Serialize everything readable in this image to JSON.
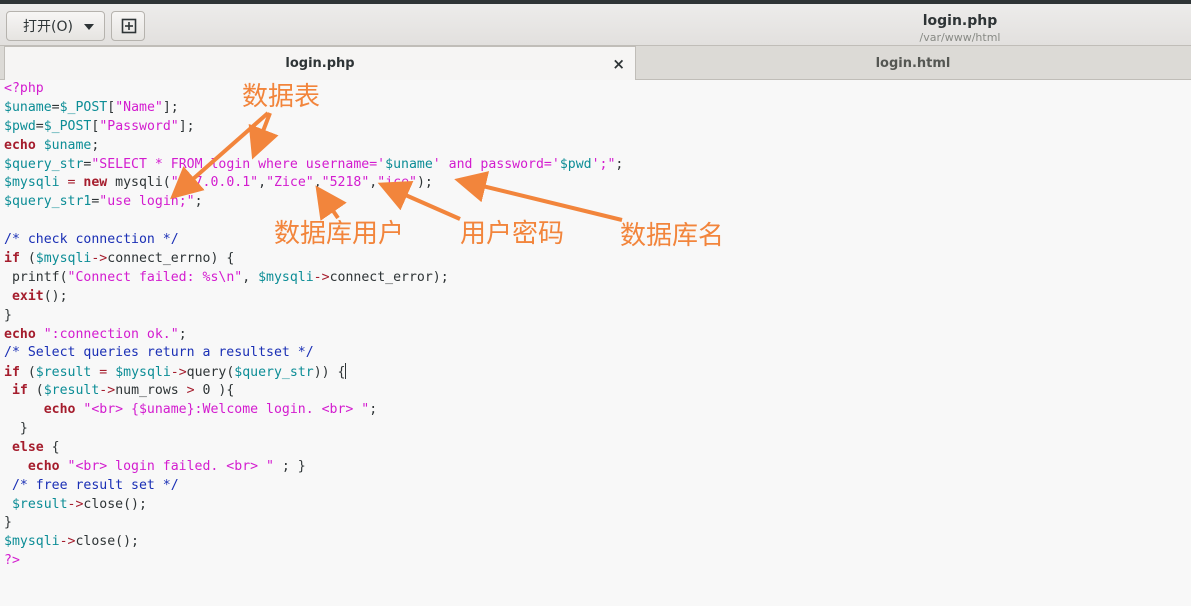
{
  "header": {
    "open_label": "打开(O)",
    "title": "login.php",
    "subtitle": "/var/www/html"
  },
  "tabs": [
    {
      "label": "login.php",
      "active": true,
      "close": "×"
    },
    {
      "label": "login.html",
      "active": false
    }
  ],
  "annotations": {
    "table": "数据表",
    "db_user": "数据库用户",
    "user_password": "用户密码",
    "db_name": "数据库名"
  },
  "colors": {
    "variable": "#0c8d96",
    "string": "#d31ccf",
    "keyword": "#a51d2d",
    "comment": "#1a2fb5",
    "annotation": "#f2853c"
  },
  "code_lines": [
    [
      [
        "p",
        "<?php"
      ]
    ],
    [
      [
        "v",
        "$uname"
      ],
      [
        "",
        "="
      ],
      [
        "v",
        "$_POST"
      ],
      [
        "",
        "["
      ],
      [
        "s",
        "\"Name\""
      ],
      [
        "",
        "];"
      ]
    ],
    [
      [
        "v",
        "$pwd"
      ],
      [
        "",
        "="
      ],
      [
        "v",
        "$_POST"
      ],
      [
        "",
        "["
      ],
      [
        "s",
        "\"Password\""
      ],
      [
        "",
        "];"
      ]
    ],
    [
      [
        "k",
        "echo"
      ],
      [
        "",
        " "
      ],
      [
        "v",
        "$uname"
      ],
      [
        "",
        ";"
      ]
    ],
    [
      [
        "v",
        "$query_str"
      ],
      [
        "",
        "="
      ],
      [
        "s",
        "\"SELECT * FROM login where username='"
      ],
      [
        "v",
        "$uname"
      ],
      [
        "s",
        "' and password='"
      ],
      [
        "v",
        "$pwd"
      ],
      [
        "s",
        "';\""
      ],
      [
        "",
        ";"
      ]
    ],
    [
      [
        "v",
        "$mysqli"
      ],
      [
        "o",
        " = "
      ],
      [
        "k",
        "new"
      ],
      [
        "",
        " mysqli("
      ],
      [
        "s",
        "\"127.0.0.1\""
      ],
      [
        "",
        ","
      ],
      [
        "s",
        "\"Zice\""
      ],
      [
        "",
        ","
      ],
      [
        "s",
        "\"5218\""
      ],
      [
        "",
        ","
      ],
      [
        "s",
        "\"ice\""
      ],
      [
        "",
        ");"
      ]
    ],
    [
      [
        "v",
        "$query_str1"
      ],
      [
        "",
        "="
      ],
      [
        "s",
        "\"use login;\""
      ],
      [
        "",
        ";"
      ]
    ],
    [],
    [
      [
        "c",
        "/* check connection */"
      ]
    ],
    [
      [
        "k",
        "if"
      ],
      [
        "",
        " ("
      ],
      [
        "v",
        "$mysqli"
      ],
      [
        "o",
        "->"
      ],
      [
        "",
        "connect_errno) {"
      ]
    ],
    [
      [
        "",
        " printf("
      ],
      [
        "s",
        "\"Connect failed: %s\\n\""
      ],
      [
        "",
        ", "
      ],
      [
        "v",
        "$mysqli"
      ],
      [
        "o",
        "->"
      ],
      [
        "",
        "connect_error);"
      ]
    ],
    [
      [
        "k",
        " exit"
      ],
      [
        "",
        "();"
      ]
    ],
    [
      [
        "",
        "}"
      ]
    ],
    [
      [
        "k",
        "echo"
      ],
      [
        "s",
        " \":connection ok.\""
      ],
      [
        "",
        ";"
      ]
    ],
    [
      [
        "c",
        "/* Select queries return a resultset */"
      ]
    ],
    [
      [
        "k",
        "if"
      ],
      [
        "",
        " ("
      ],
      [
        "v",
        "$result"
      ],
      [
        "o",
        " = "
      ],
      [
        "v",
        "$mysqli"
      ],
      [
        "o",
        "->"
      ],
      [
        "",
        "query("
      ],
      [
        "v",
        "$query_str"
      ],
      [
        "",
        ")) {"
      ]
    ],
    [
      [
        "k",
        " if"
      ],
      [
        "",
        " ("
      ],
      [
        "v",
        "$result"
      ],
      [
        "o",
        "->"
      ],
      [
        "",
        "num_rows"
      ],
      [
        "o",
        " > "
      ],
      [
        "",
        "0 ){"
      ]
    ],
    [
      [
        "k",
        "     echo"
      ],
      [
        "s",
        " \"<br> {$uname}:Welcome login. <br> \""
      ],
      [
        "",
        ";"
      ]
    ],
    [
      [
        "",
        "  }"
      ]
    ],
    [
      [
        "k",
        " else"
      ],
      [
        "",
        " {"
      ]
    ],
    [
      [
        "k",
        "   echo"
      ],
      [
        "s",
        " \"<br> login failed. <br> \""
      ],
      [
        "",
        " ; }"
      ]
    ],
    [
      [
        "c",
        " /* free result set */"
      ]
    ],
    [
      [
        "v",
        " $result"
      ],
      [
        "o",
        "->"
      ],
      [
        "",
        "close();"
      ]
    ],
    [
      [
        "",
        "}"
      ]
    ],
    [
      [
        "v",
        "$mysqli"
      ],
      [
        "o",
        "->"
      ],
      [
        "",
        "close();"
      ]
    ],
    [
      [
        "p",
        "?>"
      ]
    ]
  ]
}
